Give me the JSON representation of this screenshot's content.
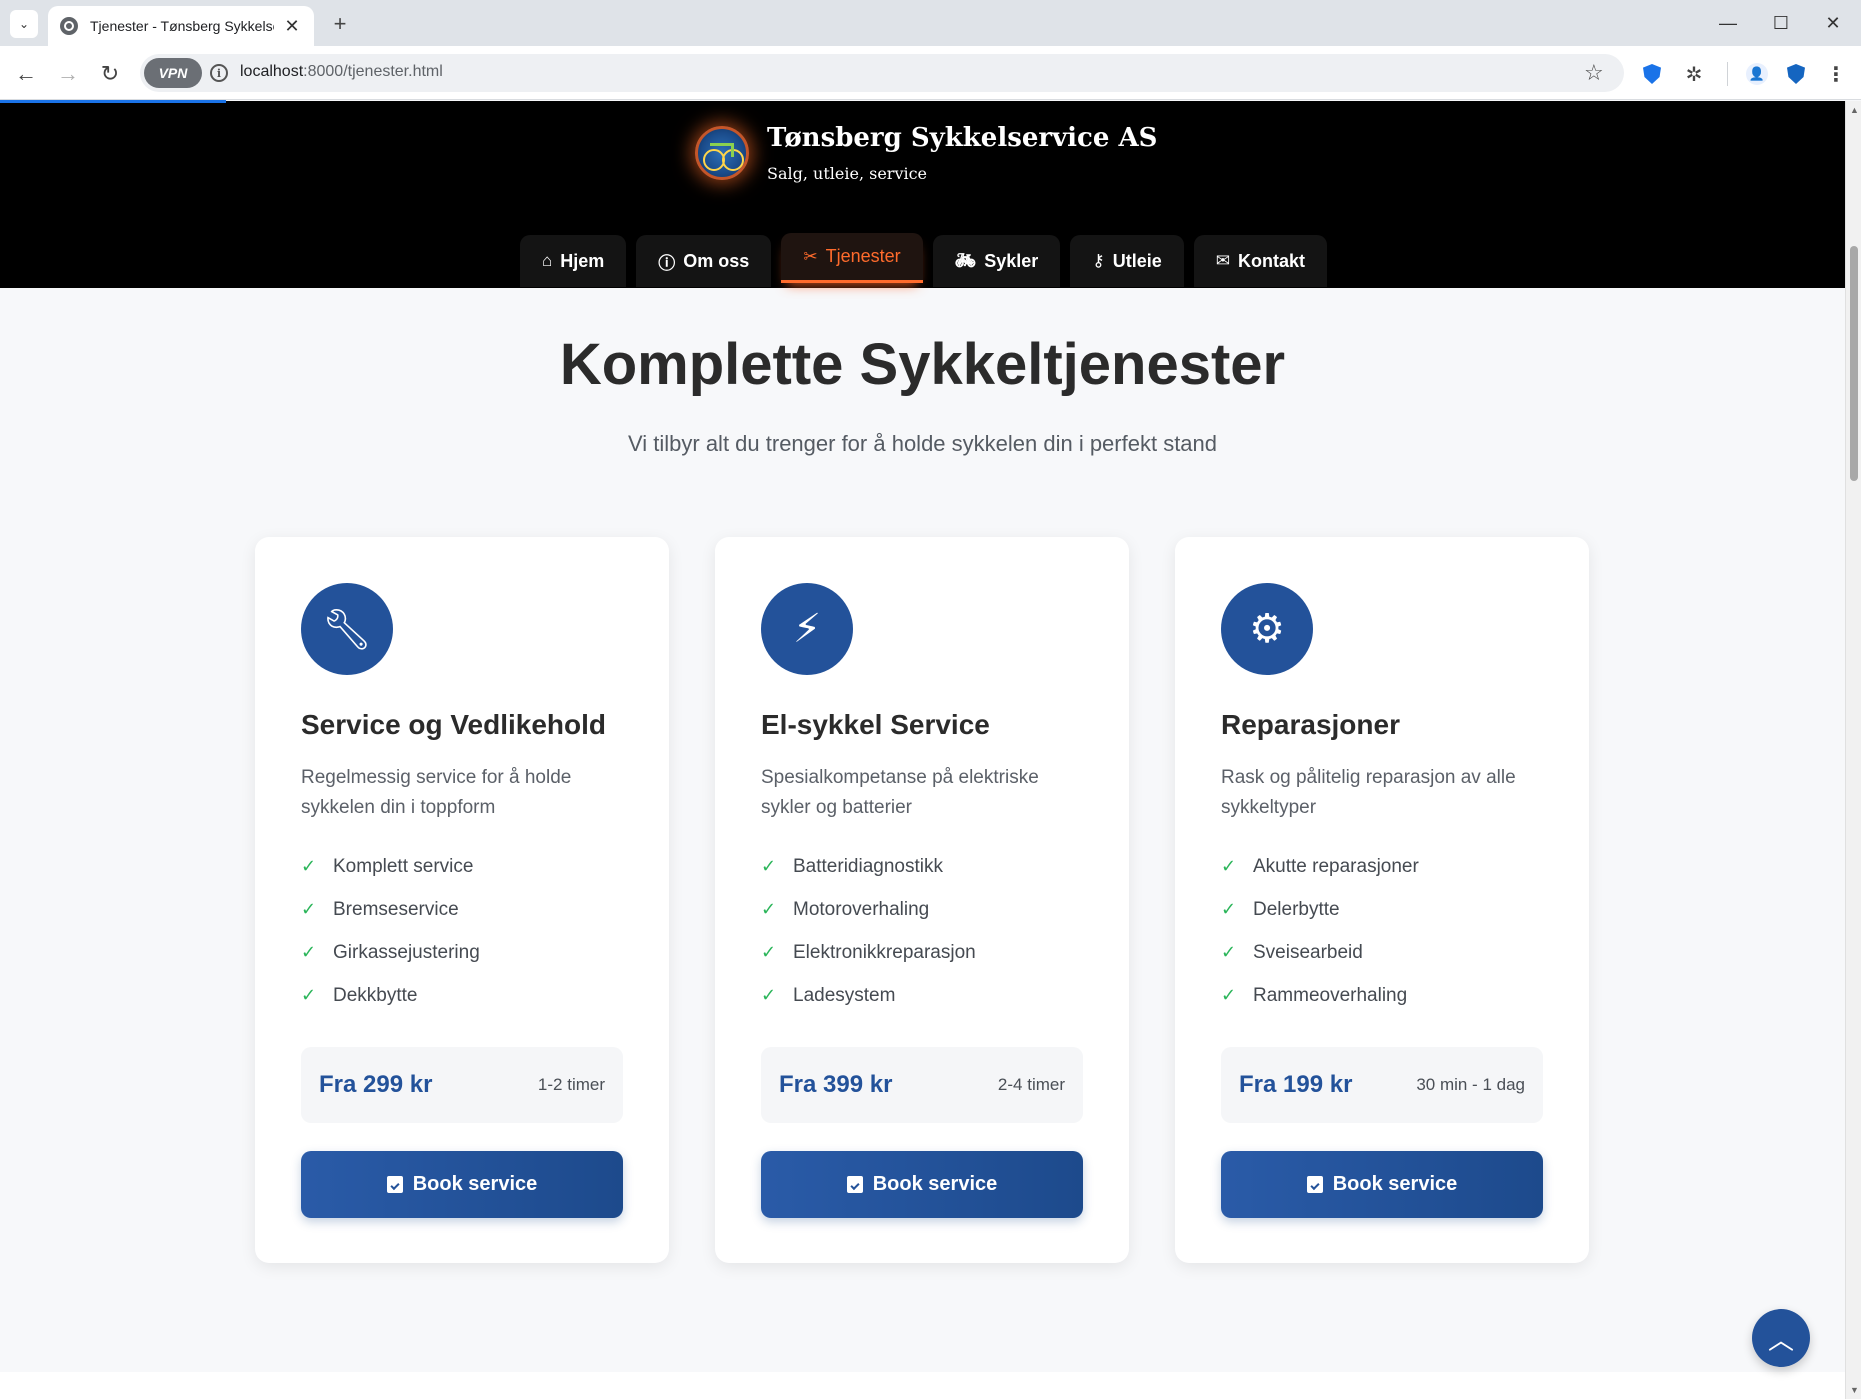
{
  "browser": {
    "tab_title": "Tjenester - Tønsberg Sykkelservice AS",
    "url_host": "localhost",
    "url_path": ":8000/tjenester.html",
    "vpn_label": "VPN"
  },
  "header": {
    "brand_name": "Tønsberg Sykkelservice AS",
    "tagline": "Salg, utleie, service"
  },
  "nav": {
    "items": [
      {
        "label": "Hjem",
        "icon": "home-icon",
        "active": false
      },
      {
        "label": "Om oss",
        "icon": "info-icon",
        "active": false
      },
      {
        "label": "Tjenester",
        "icon": "tools-icon",
        "active": true
      },
      {
        "label": "Sykler",
        "icon": "bicycle-icon",
        "active": false
      },
      {
        "label": "Utleie",
        "icon": "key-icon",
        "active": false
      },
      {
        "label": "Kontakt",
        "icon": "envelope-icon",
        "active": false
      }
    ]
  },
  "hero": {
    "title": "Komplette Sykkeltjenester",
    "subtitle": "Vi tilbyr alt du trenger for å holde sykkelen din i perfekt stand"
  },
  "services": [
    {
      "icon": "wrench-icon",
      "title": "Service og Vedlikehold",
      "description": "Regelmessig service for å holde sykkelen din i toppform",
      "features": [
        "Komplett service",
        "Bremseservice",
        "Girkassejustering",
        "Dekkbytte"
      ],
      "price": "Fra 299 kr",
      "duration": "1-2 timer",
      "button": "Book service"
    },
    {
      "icon": "bolt-icon",
      "title": "El-sykkel Service",
      "description": "Spesialkompetanse på elektriske sykler og batterier",
      "features": [
        "Batteridiagnostikk",
        "Motoroverhaling",
        "Elektronikkreparasjon",
        "Ladesystem"
      ],
      "price": "Fra 399 kr",
      "duration": "2-4 timer",
      "button": "Book service"
    },
    {
      "icon": "gear-icon",
      "title": "Reparasjoner",
      "description": "Rask og pålitelig reparasjon av alle sykkeltyper",
      "features": [
        "Akutte reparasjoner",
        "Delerbytte",
        "Sveisearbeid",
        "Rammeoverhaling"
      ],
      "price": "Fra 199 kr",
      "duration": "30 min - 1 dag",
      "button": "Book service"
    }
  ],
  "colors": {
    "primary": "#23529a",
    "accent": "#ff6b2c",
    "check": "#2bb55a",
    "header_bg": "#000000"
  }
}
